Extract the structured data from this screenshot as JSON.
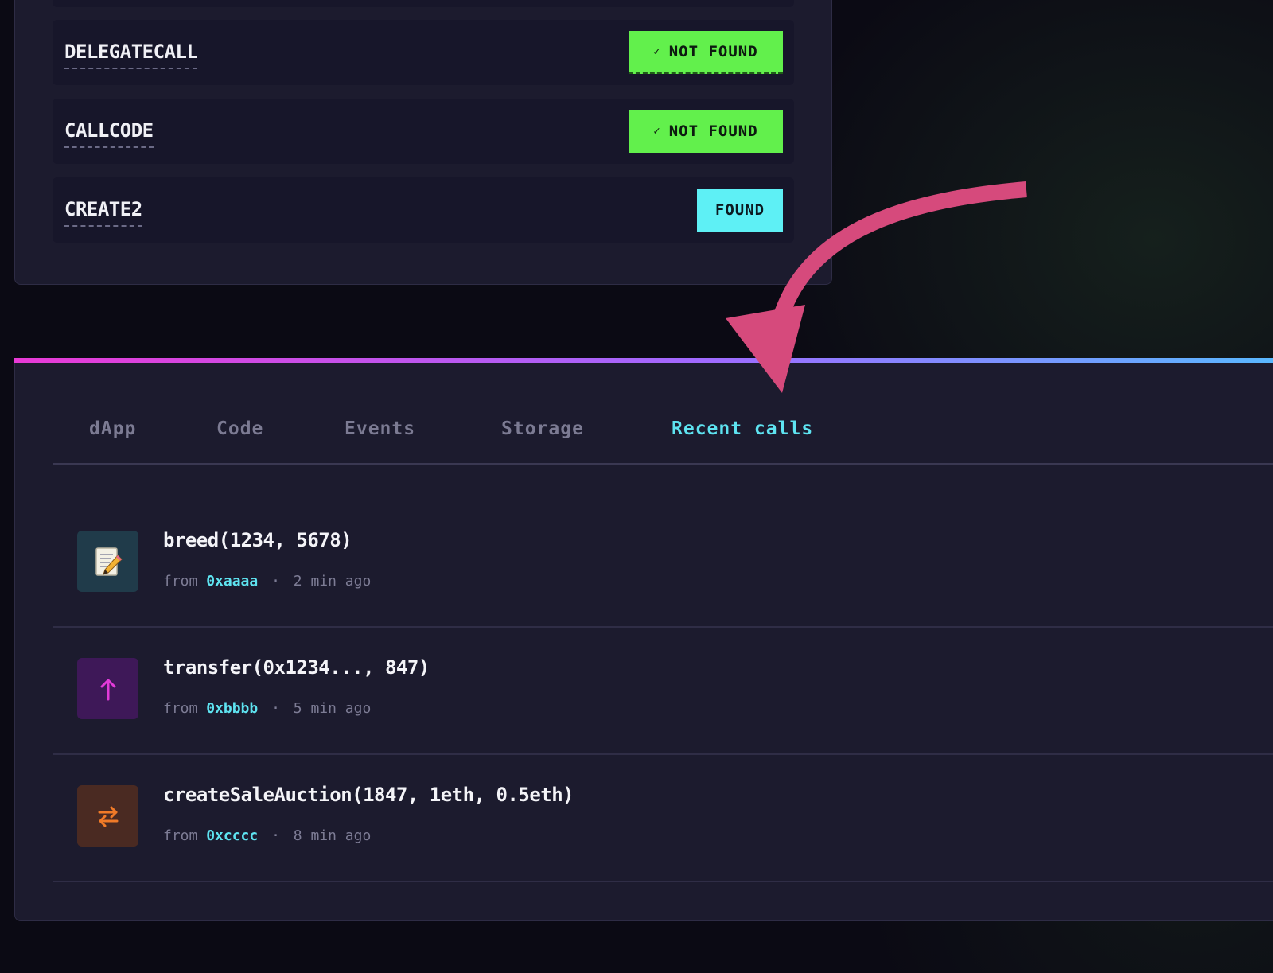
{
  "opcodes": [
    {
      "name": "DELEGATECALL",
      "status": "NOT FOUND",
      "check": "✓"
    },
    {
      "name": "CALLCODE",
      "status": "NOT FOUND",
      "check": "✓"
    },
    {
      "name": "CREATE2",
      "status": "FOUND"
    }
  ],
  "tabs": [
    {
      "label": "dApp"
    },
    {
      "label": "Code"
    },
    {
      "label": "Events"
    },
    {
      "label": "Storage"
    },
    {
      "label": "Recent calls",
      "active": true
    }
  ],
  "calls": [
    {
      "func": "breed(1234, 5678)",
      "from_label": "from",
      "address": "0xaaaa",
      "separator": "·",
      "time": "2 min ago",
      "icon": "memo-icon"
    },
    {
      "func": "transfer(0x1234..., 847)",
      "from_label": "from",
      "address": "0xbbbb",
      "separator": "·",
      "time": "5 min ago",
      "icon": "up-arrow-icon"
    },
    {
      "func": "createSaleAuction(1847, 1eth, 0.5eth)",
      "from_label": "from",
      "address": "0xcccc",
      "separator": "·",
      "time": "8 min ago",
      "icon": "swap-arrows-icon"
    }
  ],
  "colors": {
    "not_found": "#62f04c",
    "found": "#5ef0f5",
    "active_tab": "#5ee3f0",
    "annotation_arrow": "#d64a7c"
  }
}
